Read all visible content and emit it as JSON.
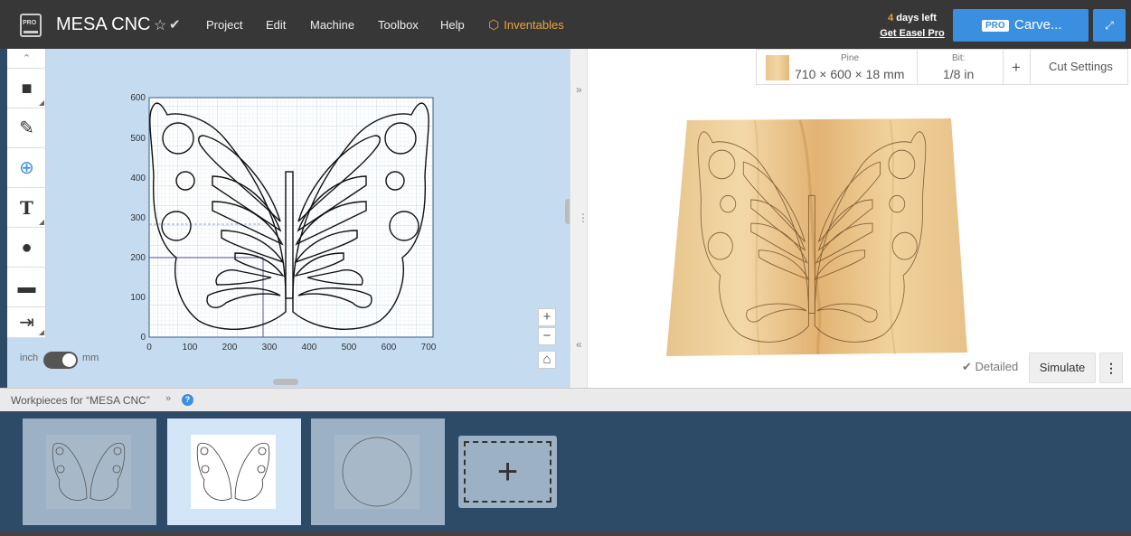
{
  "app": {
    "project_title": "MESA CNC",
    "favorite_icon": "star-icon",
    "saved_icon": "check-icon"
  },
  "menu": {
    "project": "Project",
    "edit": "Edit",
    "machine": "Machine",
    "toolbox": "Toolbox",
    "help": "Help",
    "inventables": "Inventables"
  },
  "trial": {
    "days_number": "4",
    "days_text": " days left",
    "get_pro": "Get Easel Pro"
  },
  "carve": {
    "pro_badge": "PRO",
    "label": "Carve..."
  },
  "logo": {
    "badge": "PRO"
  },
  "canvas": {
    "y_ticks": [
      "600",
      "500",
      "400",
      "300",
      "200",
      "100",
      "0"
    ],
    "x_ticks": [
      "0",
      "100",
      "200",
      "300",
      "400",
      "500",
      "600",
      "700"
    ],
    "unit_inch": "inch",
    "unit_mm": "mm",
    "selected_unit": "mm",
    "zoom_in": "+",
    "zoom_out": "−",
    "home": "⌂"
  },
  "material": {
    "name": "Pine",
    "dimensions": "710 × 600 × 18 mm",
    "bit_label": "Bit:",
    "bit_value": "1/8 in",
    "add": "+",
    "cut_settings": "Cut Settings"
  },
  "preview": {
    "detailed": "Detailed",
    "simulate": "Simulate",
    "more": "⋮"
  },
  "workpieces": {
    "header": "Workpieces for “MESA CNC”",
    "help": "?",
    "add": "+"
  },
  "colors": {
    "accent": "#3b8fe0",
    "orange": "#e8a33c",
    "topbar": "#373737",
    "workspace": "#c5dbf0",
    "workpiece_bar": "#2d4a66"
  }
}
